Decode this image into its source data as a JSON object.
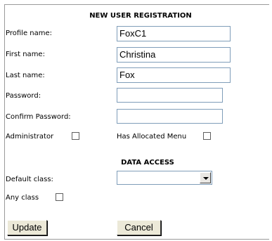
{
  "registration": {
    "title": "NEW USER REGISTRATION",
    "profile_label": "Profile name:",
    "profile_value": "FoxC1",
    "first_label": "First name:",
    "first_value": "Christina",
    "last_label": "Last name:",
    "last_value": "Fox",
    "password_label": "Password:",
    "password_value": "",
    "confirm_label": "Confirm Password:",
    "confirm_value": "",
    "admin_label": "Administrator",
    "admin_checked": false,
    "menu_label": "Has Allocated Menu",
    "menu_checked": false
  },
  "data_access": {
    "title": "DATA ACCESS",
    "default_class_label": "Default class:",
    "default_class_value": "",
    "any_class_label": "Any class",
    "any_class_checked": false
  },
  "actions": {
    "update_label": "Update",
    "cancel_label": "Cancel"
  }
}
